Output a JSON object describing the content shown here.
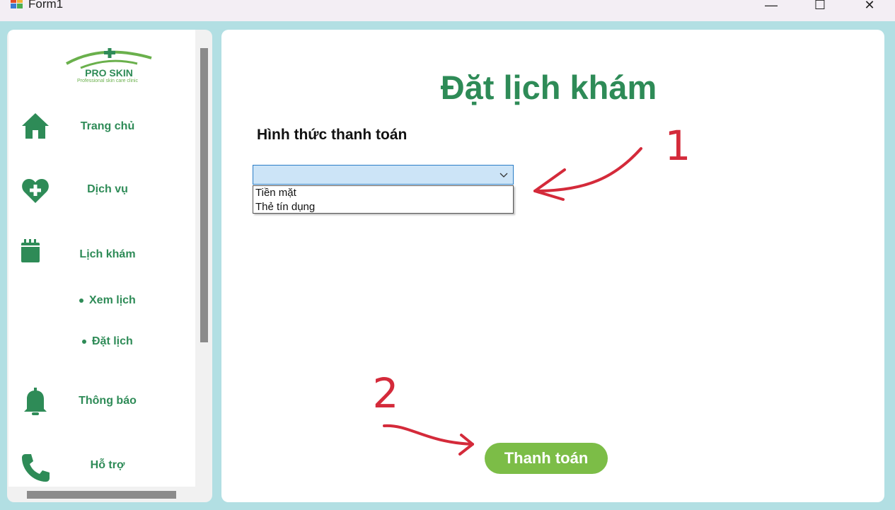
{
  "window": {
    "title": "Form1",
    "minimize": "—",
    "maximize": "☐",
    "close": "✕"
  },
  "brand": {
    "name": "PRO SKIN",
    "tagline": "Professional skin care clinic"
  },
  "sidebar": {
    "items": [
      {
        "label": "Trang chủ",
        "icon": "home-icon"
      },
      {
        "label": "Dịch vụ",
        "icon": "heart-plus-icon"
      },
      {
        "label": "Lịch khám",
        "icon": "calendar-icon"
      },
      {
        "label": "Thông báo",
        "icon": "bell-icon"
      },
      {
        "label": "Hỗ trợ",
        "icon": "phone-icon"
      }
    ],
    "subitems": [
      {
        "label": "Xem lịch"
      },
      {
        "label": "Đặt lịch"
      }
    ]
  },
  "main": {
    "title": "Đặt lịch khám",
    "payment_label": "Hình thức thanh toán",
    "payment_select": {
      "value": "",
      "options": [
        "Tiền mặt",
        "Thẻ tín dụng"
      ]
    },
    "pay_button": "Thanh toán"
  },
  "annotations": [
    {
      "label": "1"
    },
    {
      "label": "2"
    }
  ],
  "colors": {
    "accent": "#2e8b57",
    "button": "#7cbd47",
    "background": "#b2dfe3",
    "annotation": "#d42a3a"
  }
}
